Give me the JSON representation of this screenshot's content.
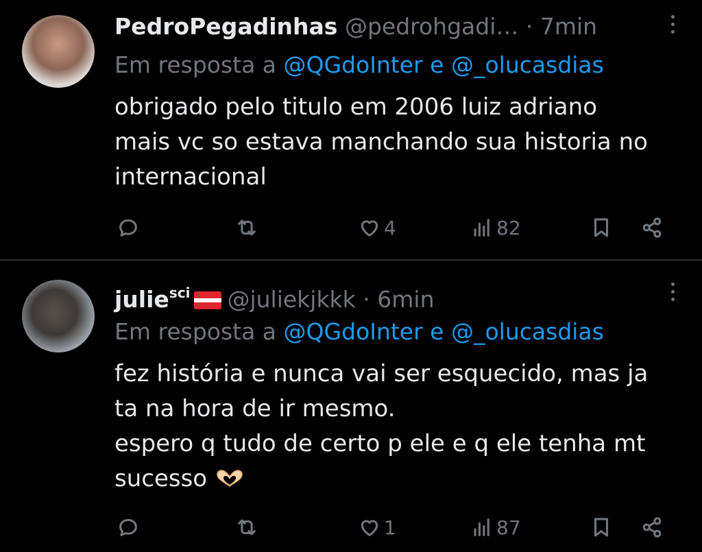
{
  "tweets": [
    {
      "name": "PedroPegadinhas",
      "name_sup": "",
      "handle": "@pedrohgadi…",
      "time": "· 7min",
      "reply_prefix": "Em resposta a",
      "mention_1": "@QGdoInter",
      "reply_and": "e",
      "mention_2": "@_olucasdias",
      "lines": [
        "obrigado pelo titulo em 2006 luiz adriano",
        "mais vc so estava manchando sua historia no",
        "internacional"
      ],
      "likes": "4",
      "views": "82"
    },
    {
      "name": "julie",
      "name_sup": "sci",
      "handle": "@juliekjkkk",
      "time": "· 6min",
      "reply_prefix": "Em resposta a",
      "mention_1": "@QGdoInter",
      "reply_and": "e",
      "mention_2": "@_olucasdias",
      "lines": [
        "fez história e nunca vai ser esquecido, mas ja",
        "ta na hora de ir mesmo.",
        "espero q tudo de certo p ele e q ele tenha mt",
        "sucesso"
      ],
      "likes": "1",
      "views": "87"
    }
  ],
  "icons": {
    "reply": "reply-icon",
    "retweet": "retweet-icon",
    "like": "heart-icon",
    "views": "views-icon",
    "bookmark": "bookmark-icon",
    "share": "share-icon",
    "more": "more-vertical-icon",
    "emoji": "heart-hands-emoji"
  },
  "colors": {
    "background": "#000000",
    "text": "#e7e9ea",
    "muted": "#71767b",
    "link": "#1d9bf0"
  }
}
